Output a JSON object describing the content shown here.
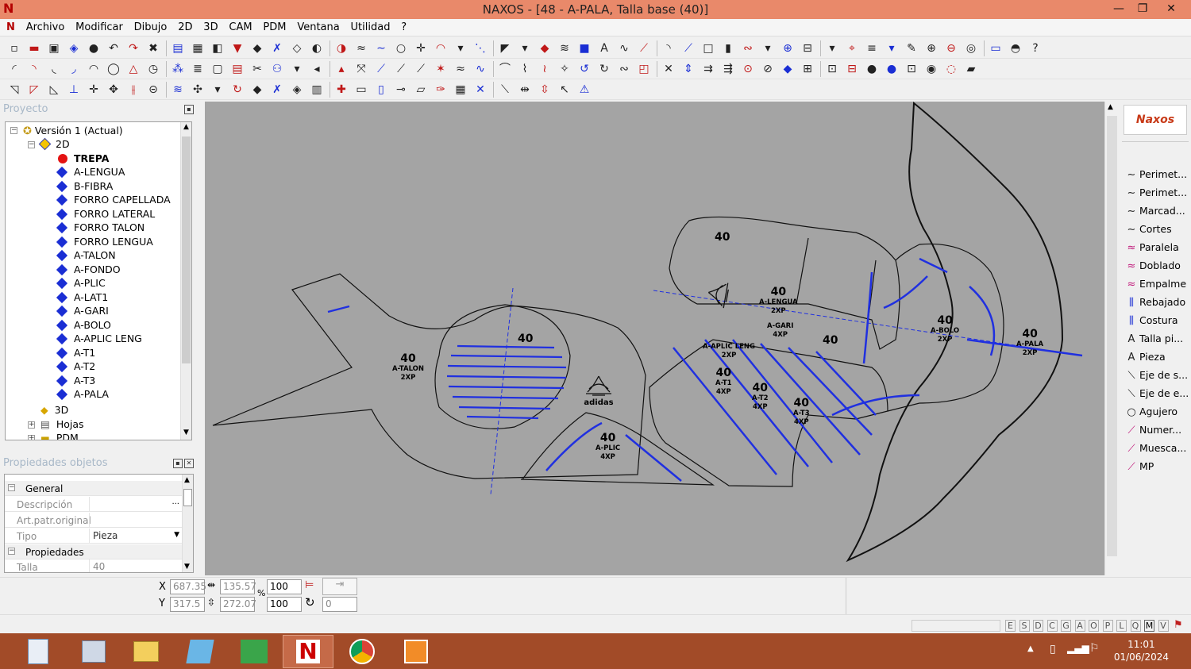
{
  "window": {
    "title": "NAXOS - [48 - A-PALA, Talla base (40)]",
    "minimize": "—",
    "maximize": "❐",
    "close": "✕"
  },
  "menu": [
    "Archivo",
    "Modificar",
    "Dibujo",
    "2D",
    "3D",
    "CAM",
    "PDM",
    "Ventana",
    "Utilidad",
    "?"
  ],
  "project_panel": {
    "title": "Proyecto",
    "tree": {
      "root": "Versión 1 (Actual)",
      "folder_2d": "2D",
      "selected": "TREPA",
      "pieces": [
        "A-LENGUA",
        "B-FIBRA",
        "FORRO CAPELLADA",
        "FORRO LATERAL",
        "FORRO TALON",
        "FORRO LENGUA",
        "A-TALON",
        "A-FONDO",
        "A-PLIC",
        "A-LAT1",
        "A-GARI",
        "A-BOLO",
        "A-APLIC LENG",
        "A-T1",
        "A-T2",
        "A-T3",
        "A-PALA"
      ],
      "folder_3d": "3D",
      "hojas": "Hojas",
      "pdm": "PDM"
    }
  },
  "properties_panel": {
    "title": "Propiedades objetos",
    "general": "General",
    "rows": [
      {
        "label": "Descripción",
        "value": ""
      },
      {
        "label": "Art.patr.original",
        "value": ""
      },
      {
        "label": "Tipo",
        "value": "Pieza"
      }
    ],
    "propiedades": "Propiedades",
    "talla_label": "Talla",
    "talla_value": "40"
  },
  "canvas": {
    "background": "#a4a4a4",
    "pieces": [
      {
        "size": "40",
        "name": "A-TALON",
        "qty": "2XP"
      },
      {
        "size": "40",
        "name": "",
        "qty": ""
      },
      {
        "size": "40",
        "name": "A-PLIC",
        "qty": "4XP"
      },
      {
        "size": "40",
        "name": "",
        "qty": ""
      },
      {
        "size": "40",
        "name": "A-LENGUA",
        "qty": "2XP"
      },
      {
        "size": "",
        "name": "A-GARI",
        "qty": "4XP"
      },
      {
        "size": "40",
        "name": "",
        "qty": ""
      },
      {
        "size": "",
        "name": "A-APLIC LENG",
        "qty": "2XP"
      },
      {
        "size": "40",
        "name": "A-T1",
        "qty": "4XP"
      },
      {
        "size": "40",
        "name": "A-T2",
        "qty": "4XP"
      },
      {
        "size": "40",
        "name": "A-T3",
        "qty": "4XP"
      },
      {
        "size": "40",
        "name": "A-BOLO",
        "qty": "2XP"
      },
      {
        "size": "40",
        "name": "A-PALA",
        "qty": "2XP"
      }
    ],
    "logo_text": "adidas"
  },
  "right_panel": {
    "logo": "Naxos",
    "items": [
      {
        "label": "Perimet...",
        "icon": "curve-icon"
      },
      {
        "label": "Perimet...",
        "icon": "curve-icon"
      },
      {
        "label": "Marcad...",
        "icon": "curve-icon"
      },
      {
        "label": "Cortes",
        "icon": "curve-icon"
      },
      {
        "label": "Paralela",
        "icon": "parallel-curve-icon"
      },
      {
        "label": "Doblado",
        "icon": "parallel-curve-icon"
      },
      {
        "label": "Empalme",
        "icon": "parallel-curve-icon"
      },
      {
        "label": "Rebajado",
        "icon": "seam-icon"
      },
      {
        "label": "Costura",
        "icon": "seam-icon"
      },
      {
        "label": "Talla pi...",
        "icon": "text-a-icon"
      },
      {
        "label": "Pieza",
        "icon": "text-a-icon"
      },
      {
        "label": "Eje de s...",
        "icon": "axis-icon"
      },
      {
        "label": "Eje de e...",
        "icon": "axis-icon"
      },
      {
        "label": "Agujero",
        "icon": "circle-icon"
      },
      {
        "label": "Numer...",
        "icon": "pen-icon"
      },
      {
        "label": "Muesca...",
        "icon": "pen-icon"
      },
      {
        "label": "MP",
        "icon": "pen-icon"
      }
    ]
  },
  "coords": {
    "x_label": "X",
    "y_label": "Y",
    "x": "687.35",
    "y": "317.5",
    "width": "135.57",
    "height": "272.07",
    "scale_x": "100",
    "scale_y": "100",
    "rotation": "0",
    "percent": "%"
  },
  "status_letters": [
    "E",
    "S",
    "D",
    "C",
    "G",
    "A",
    "O",
    "P",
    "L",
    "Q",
    "M",
    "V"
  ],
  "taskbar": {
    "time": "11:01",
    "date": "01/06/2024"
  },
  "colors": {
    "titlebar": "#e9896a",
    "taskbar": "#a24b28",
    "canvas": "#a4a4a4",
    "piece_blue": "#1a2ed4"
  }
}
